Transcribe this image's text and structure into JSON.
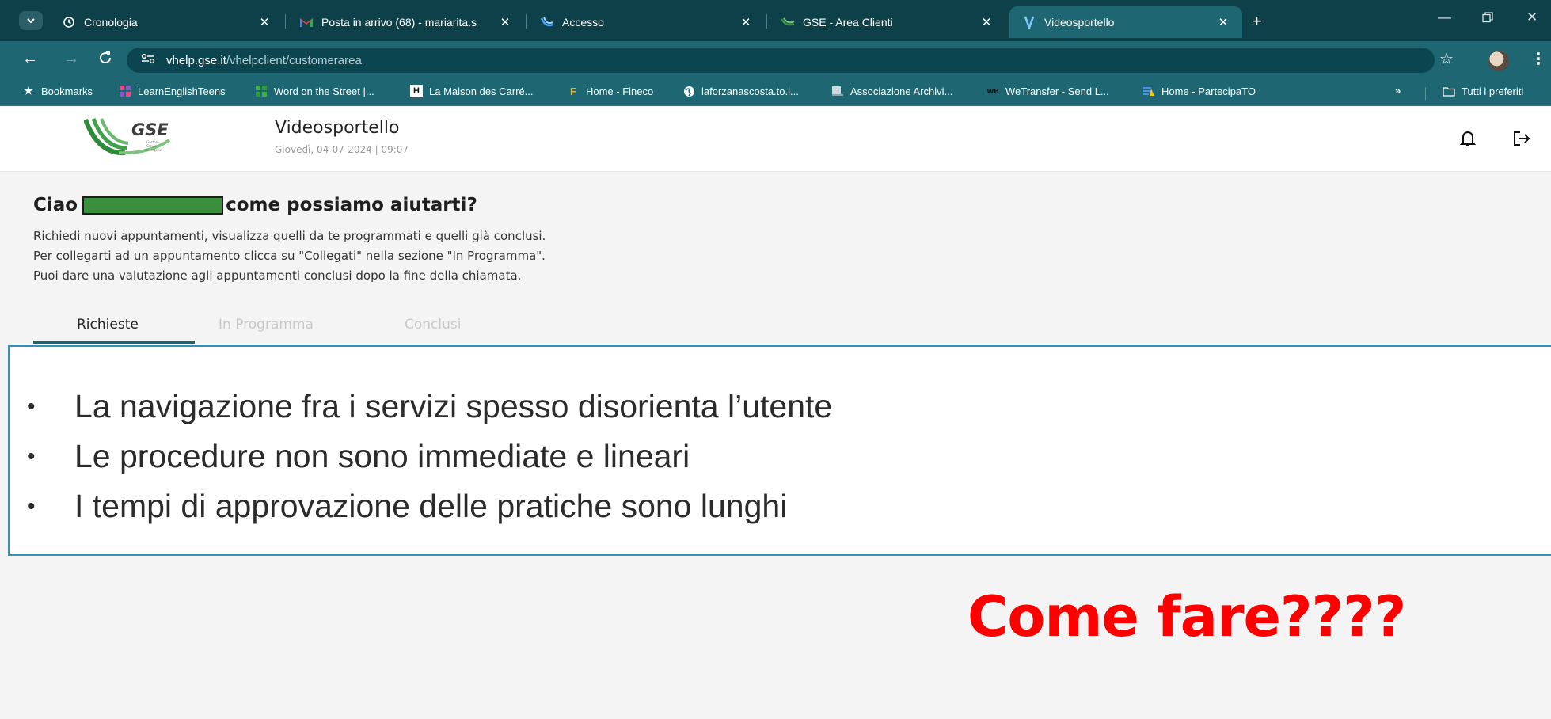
{
  "browser": {
    "tabs": [
      {
        "title": "Cronologia",
        "icon": "history-icon",
        "active": false
      },
      {
        "title": "Posta in arrivo (68) - mariarita.s",
        "icon": "gmail-icon",
        "active": false
      },
      {
        "title": "Accesso",
        "icon": "gse-favicon",
        "active": false
      },
      {
        "title": "GSE - Area Clienti",
        "icon": "gse-favicon",
        "active": false
      },
      {
        "title": "Videosportello",
        "icon": "videosportello-favicon",
        "active": true
      }
    ],
    "url_host": "vhelp.gse.it",
    "url_path": "/vhelpclient/customerarea",
    "bookmarks": [
      {
        "label": "Bookmarks",
        "icon": "star-icon"
      },
      {
        "label": "LearnEnglishTeens",
        "icon": "learnenglish-favicon"
      },
      {
        "label": "Word on the Street |...",
        "icon": "learnenglish-favicon"
      },
      {
        "label": "La Maison des Carré...",
        "icon": "maison-favicon"
      },
      {
        "label": "Home - Fineco",
        "icon": "fineco-favicon"
      },
      {
        "label": "laforzanascosta.to.i...",
        "icon": "globe-icon"
      },
      {
        "label": "Associazione Archivi...",
        "icon": "archive-favicon"
      },
      {
        "label": "WeTransfer - Send L...",
        "icon": "wetransfer-favicon"
      },
      {
        "label": "Home - PartecipaTO",
        "icon": "partecipato-favicon"
      }
    ],
    "overflow_label": "»",
    "all_bookmarks_label": "Tutti i preferiti",
    "colors": {
      "frame": "#0e4049",
      "toolbar": "#1d6672"
    }
  },
  "app": {
    "logo_text": "GSE",
    "logo_sub": "Gestore Servizi Energetici",
    "title": "Videosportello",
    "date": "Giovedì, 04-07-2024 | 09:07",
    "header_icons": [
      "bell-icon",
      "logout-icon"
    ]
  },
  "greeting": {
    "prefix": "Ciao",
    "suffix": "come possiamo aiutarti?"
  },
  "intro": [
    "Richiedi nuovi appuntamenti, visualizza quelli da te programmati e quelli già conclusi.",
    "Per collegarti ad un appuntamento clicca su \"Collegati\" nella sezione \"In Programma\".",
    "Puoi dare una valutazione agli appuntamenti conclusi dopo la fine della chiamata."
  ],
  "page_tabs": [
    {
      "label": "Richieste",
      "active": true
    },
    {
      "label": "In Programma",
      "active": false
    },
    {
      "label": "Conclusi",
      "active": false
    }
  ],
  "callout": {
    "bullets": [
      "La navigazione fra i servizi spesso disorienta l’utente",
      "Le procedure non sono immediate e lineari",
      "I tempi di approvazione delle pratiche sono lunghi"
    ]
  },
  "headline": "Come fare????",
  "colors": {
    "headline": "#ff0000",
    "callout_border": "#3591b4",
    "redaction": "#3a8f3c"
  }
}
